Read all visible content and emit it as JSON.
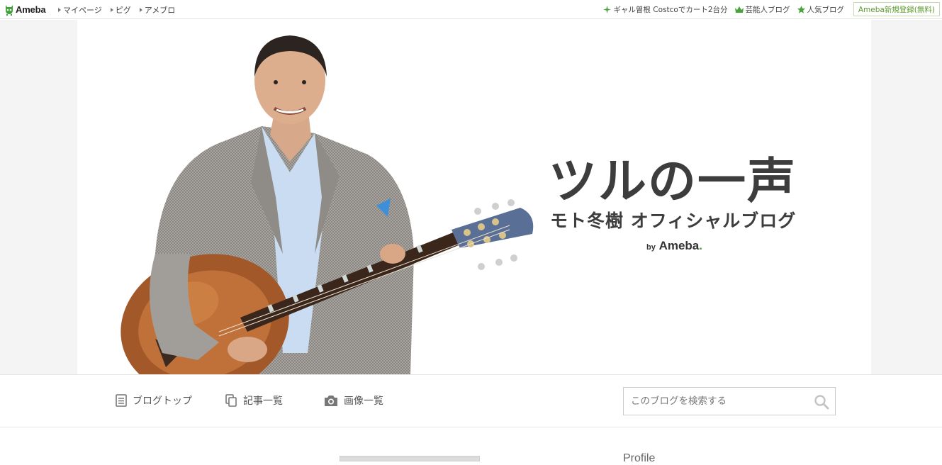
{
  "topbar": {
    "logo": "Ameba",
    "nav": [
      {
        "label": "マイページ"
      },
      {
        "label": "ピグ"
      },
      {
        "label": "アメブロ"
      }
    ],
    "right_links": [
      {
        "label": "ギャル曽根 Costcoでカート2台分",
        "icon": "sparkle-icon"
      },
      {
        "label": "芸能人ブログ",
        "icon": "crown-icon"
      },
      {
        "label": "人気ブログ",
        "icon": "star-icon"
      }
    ],
    "signup": "Ameba新規登録(無料)"
  },
  "header": {
    "title": "ツルの一声",
    "subtitle": "モト冬樹 オフィシャルブログ",
    "by": "by",
    "brand": "Ameba",
    "brand_dot": "."
  },
  "blognav": {
    "items": [
      {
        "label": "ブログトップ",
        "icon": "document-icon"
      },
      {
        "label": "記事一覧",
        "icon": "copy-icon"
      },
      {
        "label": "画像一覧",
        "icon": "camera-icon"
      }
    ],
    "search_placeholder": "このブログを検索する"
  },
  "sidebar": {
    "profile_heading": "Profile"
  },
  "colors": {
    "accent_green": "#5b9a2c",
    "title_text": "#3d3d3d"
  }
}
